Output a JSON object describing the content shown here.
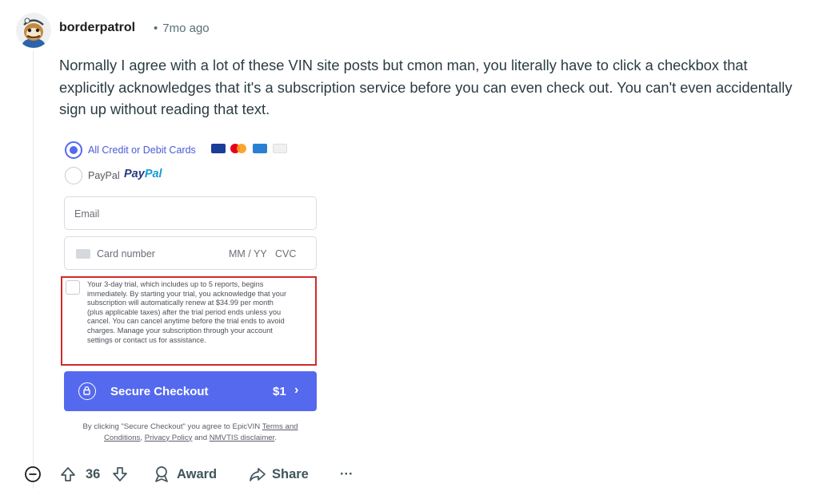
{
  "comment": {
    "author": "borderpatrol",
    "separator": "•",
    "time": "7mo ago",
    "body": "Normally I agree with a lot of these VIN site posts but cmon man, you literally have to click a checkbox that explicitly acknowledges that it's a subscription service before you can even check out. You can't even accidentally sign up without reading that text."
  },
  "screenshot": {
    "payment_options": {
      "cards_label": "All Credit or Debit Cards",
      "paypal_label": "PayPal",
      "paypal_logo_a": "Pay",
      "paypal_logo_b": "Pal"
    },
    "email_placeholder": "Email",
    "card_number_placeholder": "Card number",
    "expiry_placeholder": "MM / YY",
    "cvc_placeholder": "CVC",
    "disclaimer_lines": [
      "Your 3-day trial, which includes up to 5 reports, begins",
      "immediately. By starting your trial, you acknowledge that your",
      "subscription will automatically renew at $34.99 per month",
      "(plus applicable taxes) after the trial period ends unless you",
      "cancel. You can cancel anytime before the trial ends to avoid",
      "charges. Manage your subscription through your account",
      "settings or contact us for assistance."
    ],
    "checkout_label": "Secure Checkout",
    "checkout_price": "$1",
    "terms": {
      "prefix": "By clicking \"Secure Checkout\" you agree to EpicVIN ",
      "link1": "Terms and Conditions",
      "sep1": ", ",
      "link2": "Privacy Policy",
      "sep2": " and ",
      "link3": "NMVTIS disclaimer",
      "suffix": "."
    },
    "colors": {
      "accent": "#5569ef",
      "highlight_border": "#d12a2a"
    }
  },
  "actions": {
    "vote_count": "36",
    "award_label": "Award",
    "share_label": "Share",
    "more_label": "···"
  }
}
